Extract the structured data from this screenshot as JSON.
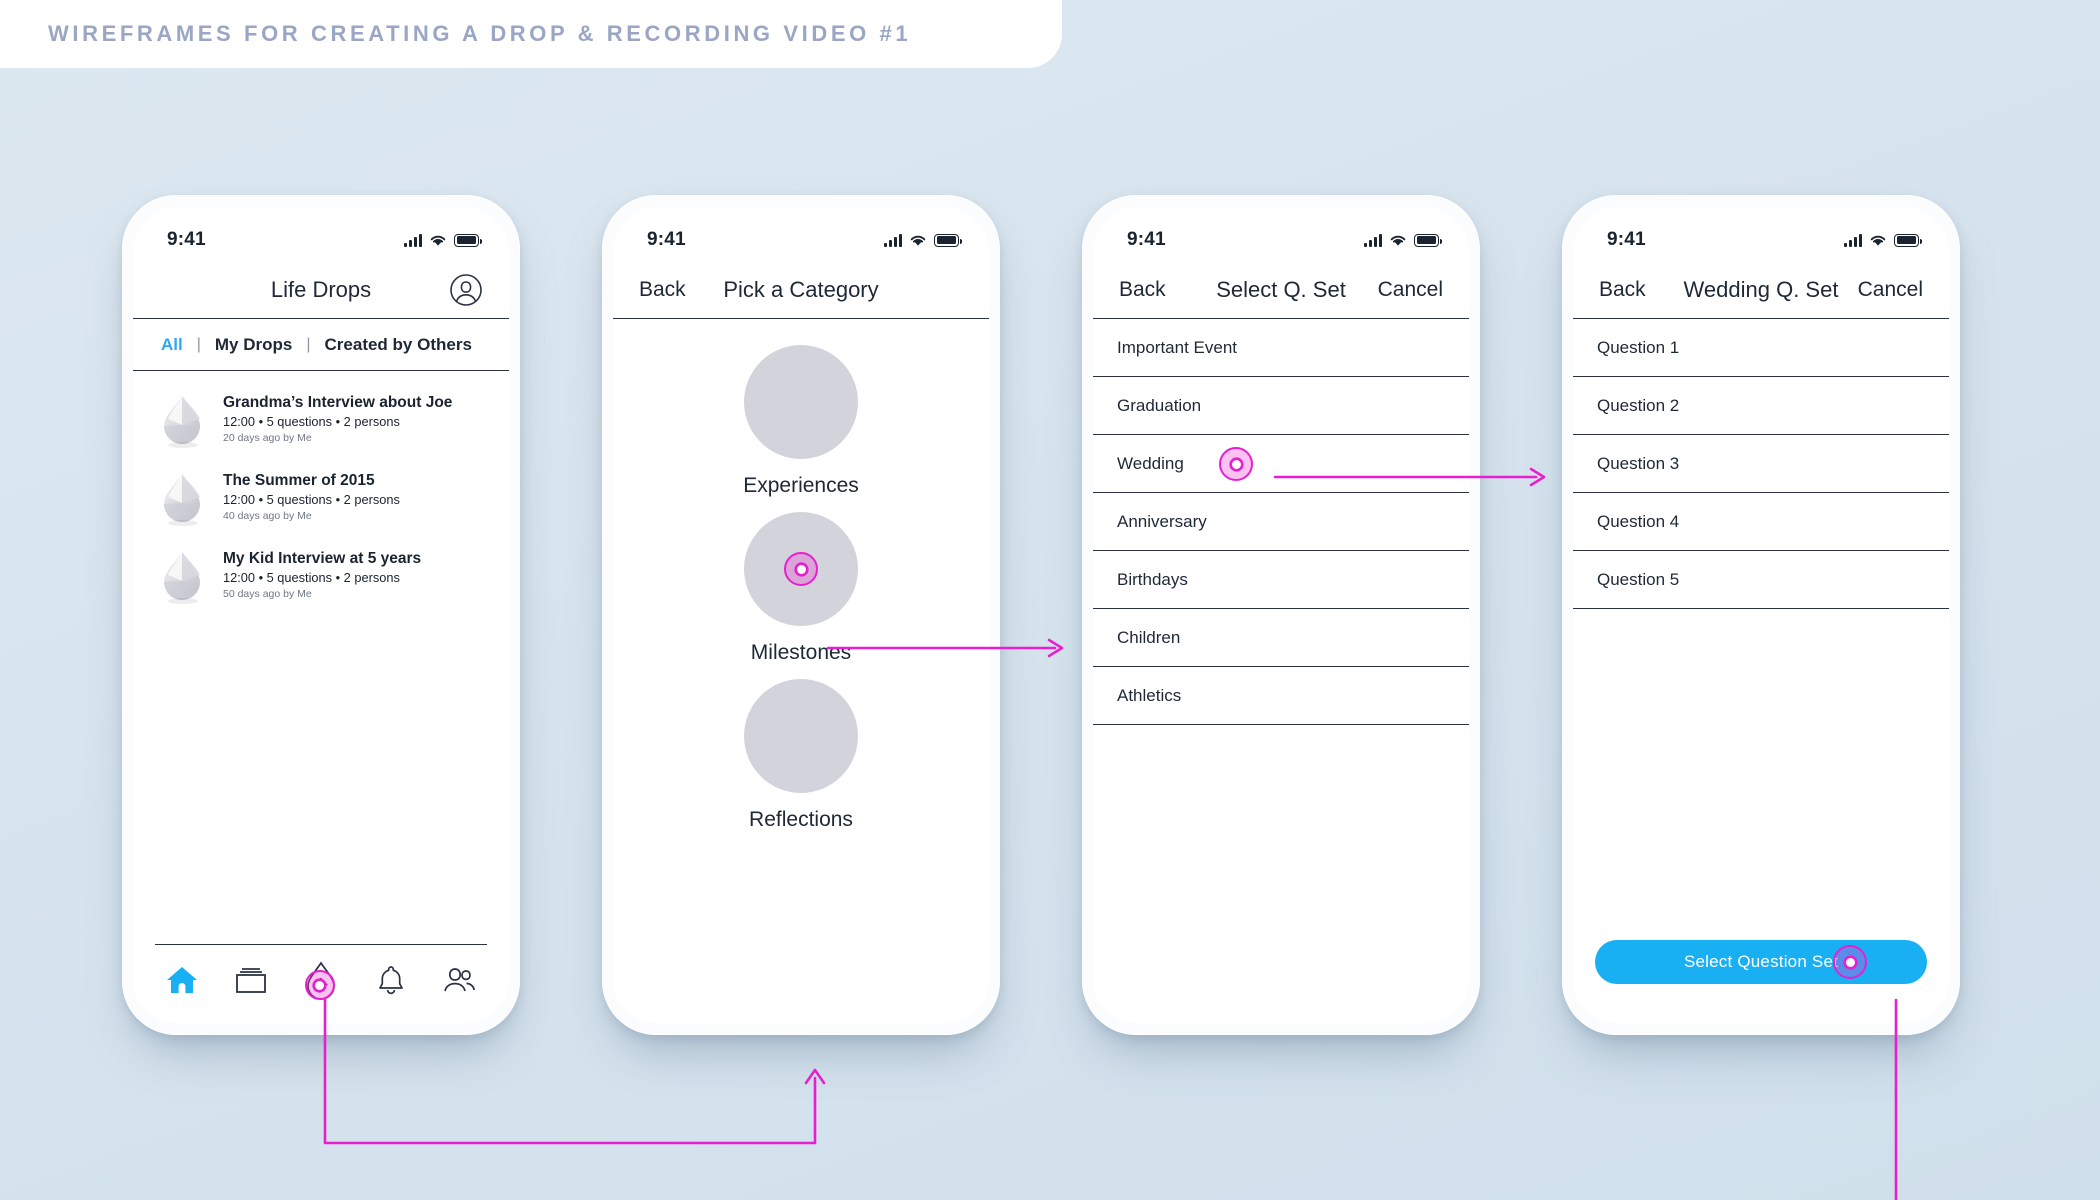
{
  "banner": {
    "title": "WIREFRAMES FOR CREATING A DROP & RECORDING VIDEO #1"
  },
  "colors": {
    "accent_blue": "#18b0f3",
    "tab_active": "#2fa8f4",
    "marker_magenta": "#e81fd0",
    "background": "#d7e4ee",
    "circle_gray": "#d3d3dc",
    "text_dark": "#1f2836"
  },
  "status_bar": {
    "time": "9:41",
    "signal_icon": "cellular-bars-icon",
    "wifi_icon": "wifi-icon",
    "battery_icon": "battery-full-icon"
  },
  "screen1": {
    "nav": {
      "title": "Life Drops",
      "avatar_icon": "user-avatar-icon"
    },
    "tabs": [
      {
        "label": "All",
        "active": true
      },
      {
        "label": "My Drops",
        "active": false
      },
      {
        "label": "Created by Others",
        "active": false
      }
    ],
    "tab_separator": "|",
    "drops": [
      {
        "title": "Grandma’s Interview about Joe",
        "subtitle": "12:00 • 5 questions • 2 persons",
        "ago": "20 days ago by Me",
        "thumb_icon": "drop-thumbnail-icon"
      },
      {
        "title": "The Summer of 2015",
        "subtitle": "12:00 • 5 questions • 2 persons",
        "ago": "40 days ago by Me",
        "thumb_icon": "drop-thumbnail-icon"
      },
      {
        "title": "My Kid Interview at 5 years",
        "subtitle": "12:00 • 5 questions • 2 persons",
        "ago": "50 days ago by Me",
        "thumb_icon": "drop-thumbnail-icon"
      }
    ],
    "tabbar": [
      {
        "icon": "home-icon",
        "active": true
      },
      {
        "icon": "cards-icon",
        "active": false
      },
      {
        "icon": "add-drop-icon",
        "active": false,
        "tapped": true
      },
      {
        "icon": "bell-icon",
        "active": false
      },
      {
        "icon": "people-icon",
        "active": false
      }
    ]
  },
  "screen2": {
    "nav": {
      "back": "Back",
      "title": "Pick a Category"
    },
    "categories": [
      {
        "label": "Experiences",
        "tapped": false
      },
      {
        "label": "Milestones",
        "tapped": true
      },
      {
        "label": "Reflections",
        "tapped": false
      }
    ]
  },
  "screen3": {
    "nav": {
      "back": "Back",
      "title": "Select Q. Set",
      "cancel": "Cancel"
    },
    "rows": [
      {
        "label": "Important Event",
        "tapped": false
      },
      {
        "label": "Graduation",
        "tapped": false
      },
      {
        "label": "Wedding",
        "tapped": true
      },
      {
        "label": "Anniversary",
        "tapped": false
      },
      {
        "label": "Birthdays",
        "tapped": false
      },
      {
        "label": "Children",
        "tapped": false
      },
      {
        "label": "Athletics",
        "tapped": false
      }
    ]
  },
  "screen4": {
    "nav": {
      "back": "Back",
      "title": "Wedding Q. Set",
      "cancel": "Cancel"
    },
    "rows": [
      {
        "label": "Question 1"
      },
      {
        "label": "Question 2"
      },
      {
        "label": "Question 3"
      },
      {
        "label": "Question 4"
      },
      {
        "label": "Question 5"
      }
    ],
    "cta": {
      "label": "Select Question Set",
      "tapped": true
    }
  }
}
